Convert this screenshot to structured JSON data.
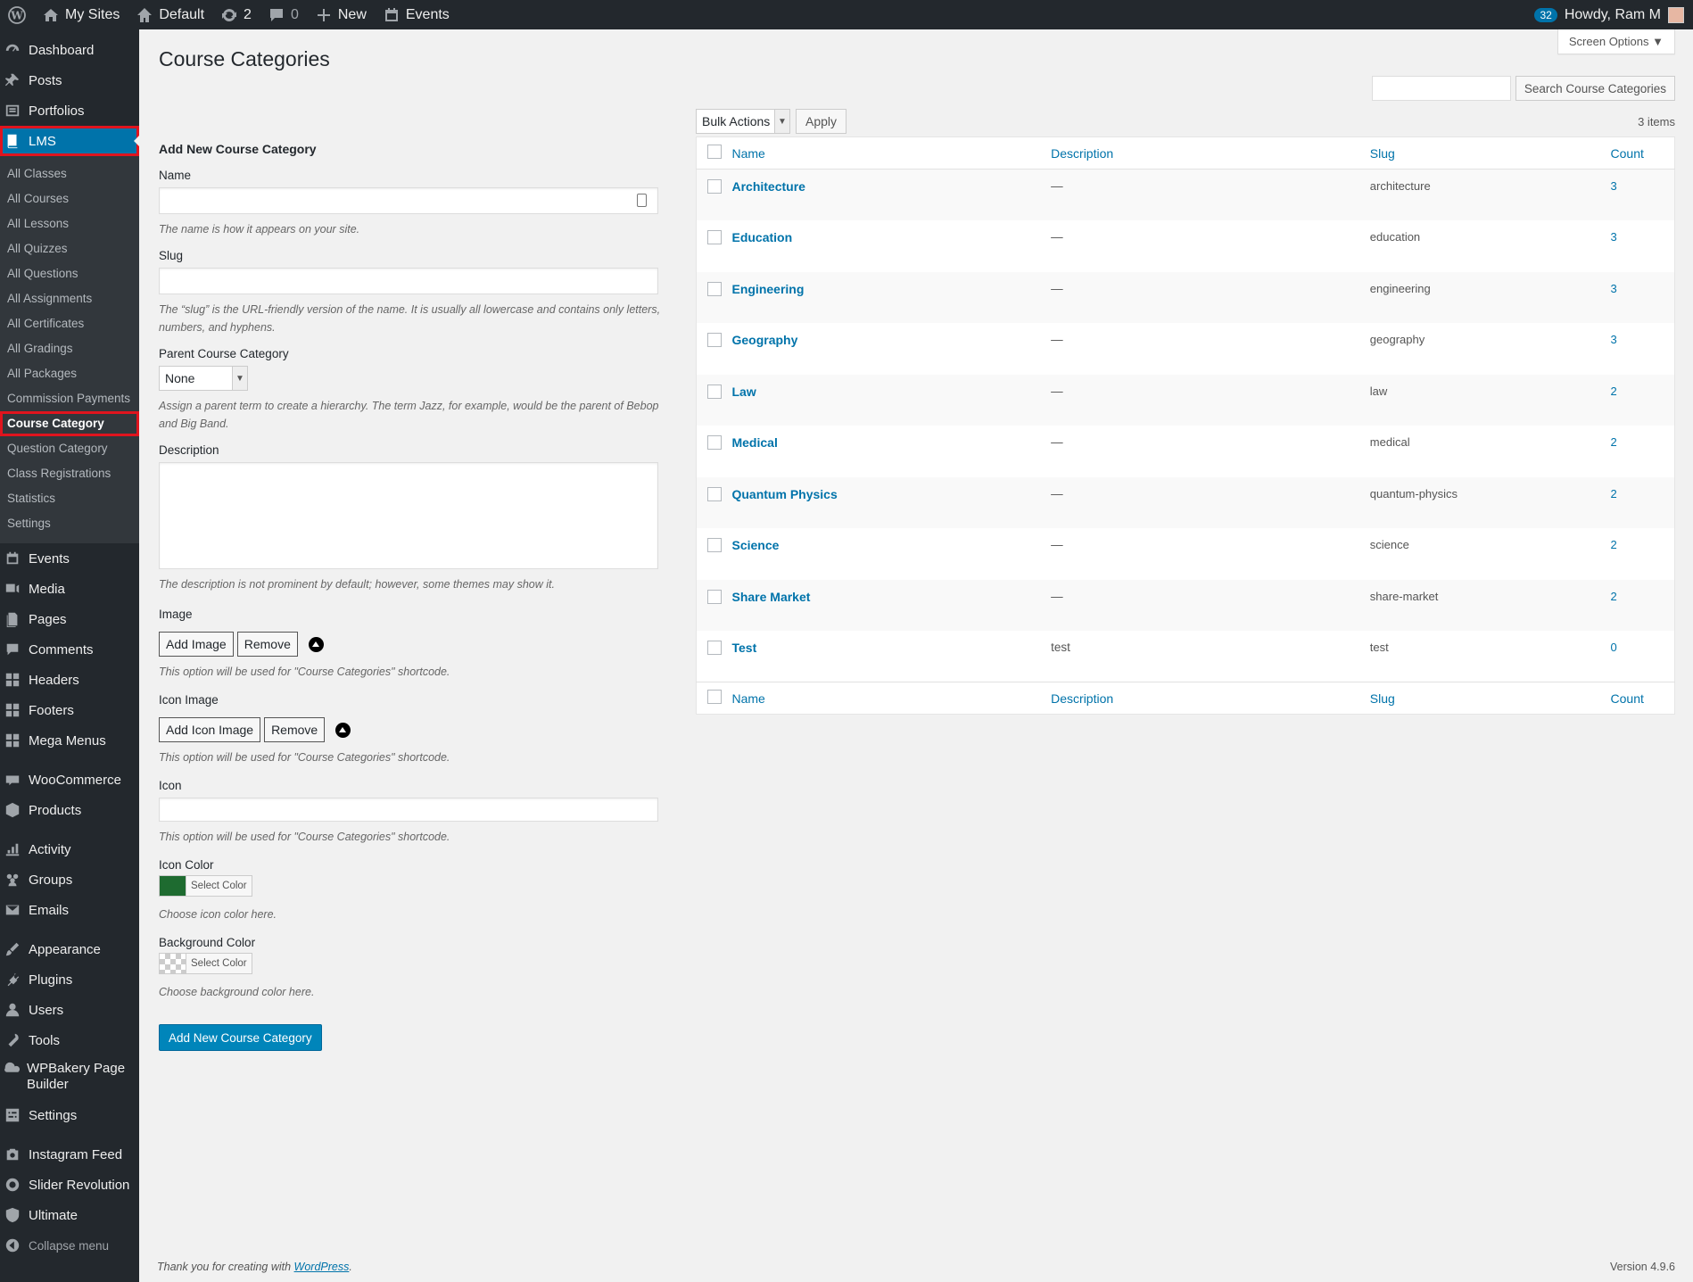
{
  "adminbar": {
    "my_sites": "My Sites",
    "site_name": "Default",
    "updates_count": "2",
    "comments_count": "0",
    "new_label": "New",
    "events_label": "Events",
    "notifications": "32",
    "howdy": "Howdy, Ram M"
  },
  "sidebar": {
    "dashboard": "Dashboard",
    "posts": "Posts",
    "portfolios": "Portfolios",
    "lms": "LMS",
    "lms_sub": [
      "All Classes",
      "All Courses",
      "All Lessons",
      "All Quizzes",
      "All Questions",
      "All Assignments",
      "All Certificates",
      "All Gradings",
      "All Packages",
      "Commission Payments",
      "Course Category",
      "Question Category",
      "Class Registrations",
      "Statistics",
      "Settings"
    ],
    "events": "Events",
    "media": "Media",
    "pages": "Pages",
    "comments": "Comments",
    "headers": "Headers",
    "footers": "Footers",
    "mega_menus": "Mega Menus",
    "woocommerce": "WooCommerce",
    "products": "Products",
    "activity": "Activity",
    "groups": "Groups",
    "emails": "Emails",
    "appearance": "Appearance",
    "plugins": "Plugins",
    "users": "Users",
    "tools": "Tools",
    "wpbakery": "WPBakery Page Builder",
    "settings": "Settings",
    "instagram": "Instagram Feed",
    "slider": "Slider Revolution",
    "ultimate": "Ultimate",
    "collapse": "Collapse menu"
  },
  "page": {
    "title": "Course Categories",
    "screen_options": "Screen Options"
  },
  "form": {
    "heading": "Add New Course Category",
    "name_label": "Name",
    "name_hint": "The name is how it appears on your site.",
    "slug_label": "Slug",
    "slug_hint": "The “slug” is the URL-friendly version of the name. It is usually all lowercase and contains only letters, numbers, and hyphens.",
    "parent_label": "Parent Course Category",
    "parent_value": "None",
    "parent_hint": "Assign a parent term to create a hierarchy. The term Jazz, for example, would be the parent of Bebop and Big Band.",
    "desc_label": "Description",
    "desc_hint": "The description is not prominent by default; however, some themes may show it.",
    "image_label": "Image",
    "add_image": "Add Image",
    "remove": "Remove",
    "image_hint": "This option will be used for \"Course Categories\" shortcode.",
    "icon_image_label": "Icon Image",
    "add_icon_image": "Add Icon Image",
    "icon_image_hint": "This option will be used for \"Course Categories\" shortcode.",
    "icon_label": "Icon",
    "icon_hint": "This option will be used for \"Course Categories\" shortcode.",
    "icon_color_label": "Icon Color",
    "icon_color_value": "#1e6b30",
    "select_color": "Select Color",
    "icon_color_hint": "Choose icon color here.",
    "bg_color_label": "Background Color",
    "bg_color_hint": "Choose background color here.",
    "submit": "Add New Course Category"
  },
  "table": {
    "search_button": "Search Course Categories",
    "bulk_actions": "Bulk Actions",
    "apply": "Apply",
    "items_count": "3 items",
    "columns": {
      "name": "Name",
      "description": "Description",
      "slug": "Slug",
      "count": "Count"
    },
    "rows": [
      {
        "name": "Architecture",
        "description": "—",
        "slug": "architecture",
        "count": "3"
      },
      {
        "name": "Education",
        "description": "—",
        "slug": "education",
        "count": "3"
      },
      {
        "name": "Engineering",
        "description": "—",
        "slug": "engineering",
        "count": "3"
      },
      {
        "name": "Geography",
        "description": "—",
        "slug": "geography",
        "count": "3"
      },
      {
        "name": "Law",
        "description": "—",
        "slug": "law",
        "count": "2"
      },
      {
        "name": "Medical",
        "description": "—",
        "slug": "medical",
        "count": "2"
      },
      {
        "name": "Quantum Physics",
        "description": "—",
        "slug": "quantum-physics",
        "count": "2"
      },
      {
        "name": "Science",
        "description": "—",
        "slug": "science",
        "count": "2"
      },
      {
        "name": "Share Market",
        "description": "—",
        "slug": "share-market",
        "count": "2"
      },
      {
        "name": "Test",
        "description": "test",
        "slug": "test",
        "count": "0"
      }
    ]
  },
  "footer": {
    "thanks_prefix": "Thank you for creating with ",
    "wordpress": "WordPress",
    "thanks_suffix": ".",
    "version": "Version 4.9.6"
  }
}
